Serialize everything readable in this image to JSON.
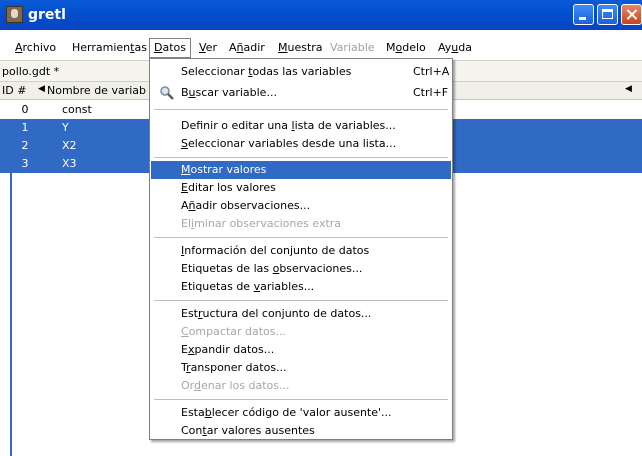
{
  "window": {
    "title": "gretl"
  },
  "menubar": [
    {
      "pre": "",
      "u": "A",
      "post": "rchivo",
      "state": "normal"
    },
    {
      "pre": "Herramien",
      "u": "t",
      "post": "as",
      "state": "normal"
    },
    {
      "pre": "",
      "u": "D",
      "post": "atos",
      "state": "active"
    },
    {
      "pre": "",
      "u": "V",
      "post": "er",
      "state": "normal"
    },
    {
      "pre": "A",
      "u": "ñ",
      "post": "adir",
      "state": "normal"
    },
    {
      "pre": "",
      "u": "M",
      "post": "uestra",
      "state": "normal"
    },
    {
      "pre": "Variable",
      "u": "",
      "post": "",
      "state": "disabled"
    },
    {
      "pre": "M",
      "u": "o",
      "post": "delo",
      "state": "normal"
    },
    {
      "pre": "Ay",
      "u": "u",
      "post": "da",
      "state": "normal"
    }
  ],
  "document": {
    "filename": "pollo.gdt *"
  },
  "table": {
    "headers": {
      "id": "ID #",
      "name": "Nombre de variab"
    },
    "rows": [
      {
        "id": "0",
        "name": "const",
        "selected": false
      },
      {
        "id": "1",
        "name": "Y",
        "selected": true
      },
      {
        "id": "2",
        "name": "X2",
        "selected": true
      },
      {
        "id": "3",
        "name": "X3",
        "selected": true
      }
    ]
  },
  "datos_menu": {
    "items": [
      {
        "pre": "Seleccionar ",
        "u": "t",
        "post": "odas las variables",
        "shortcut": "Ctrl+A"
      },
      {
        "pre": "B",
        "u": "u",
        "post": "scar variable...",
        "shortcut": "Ctrl+F",
        "icon": "magnifier-icon"
      },
      {
        "pre": "Definir o editar una ",
        "u": "l",
        "post": "ista de variables..."
      },
      {
        "pre": "",
        "u": "S",
        "post": "eleccionar variables desde una lista..."
      },
      {
        "pre": "",
        "u": "M",
        "post": "ostrar valores",
        "highlighted": true
      },
      {
        "pre": "",
        "u": "E",
        "post": "ditar los valores"
      },
      {
        "pre": "A",
        "u": "ñ",
        "post": "adir observaciones..."
      },
      {
        "pre": "El",
        "u": "i",
        "post": "minar observaciones extra",
        "disabled": true
      },
      {
        "pre": "",
        "u": "I",
        "post": "nformación del conjunto de datos"
      },
      {
        "pre": "Etiquetas de las ",
        "u": "o",
        "post": "bservaciones..."
      },
      {
        "pre": "Etiquetas de ",
        "u": "v",
        "post": "ariables..."
      },
      {
        "pre": "Est",
        "u": "r",
        "post": "uctura del conjunto de datos..."
      },
      {
        "pre": "",
        "u": "C",
        "post": "ompactar datos...",
        "disabled": true
      },
      {
        "pre": "E",
        "u": "x",
        "post": "pandir datos..."
      },
      {
        "pre": "T",
        "u": "r",
        "post": "ansponer datos..."
      },
      {
        "pre": "Or",
        "u": "d",
        "post": "enar los datos...",
        "disabled": true
      },
      {
        "pre": "Esta",
        "u": "b",
        "post": "lecer código de 'valor ausente'..."
      },
      {
        "pre": "Con",
        "u": "t",
        "post": "ar valores ausentes"
      }
    ]
  }
}
